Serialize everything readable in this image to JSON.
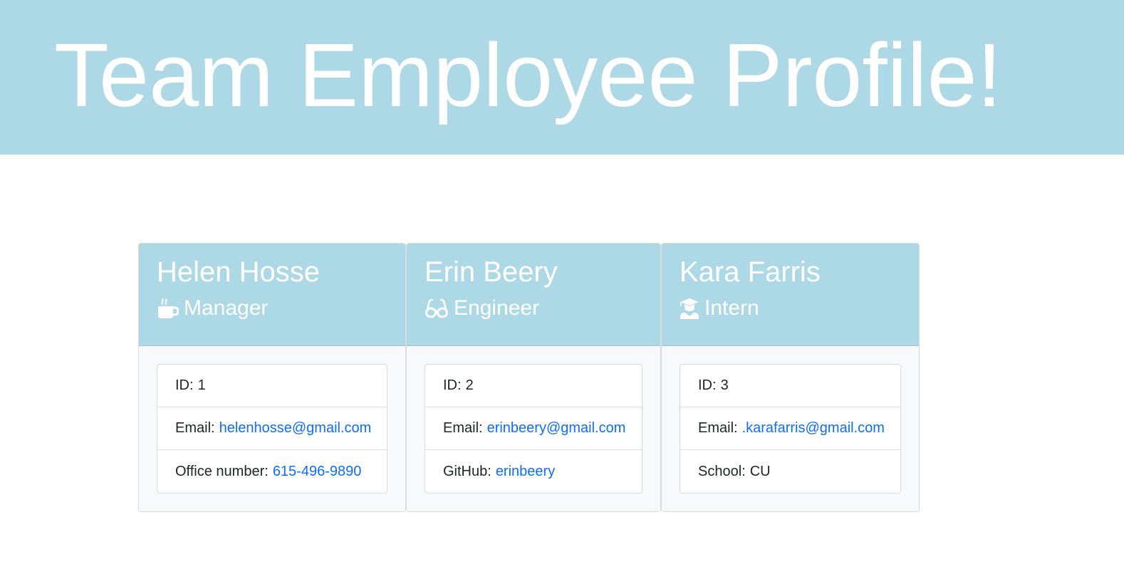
{
  "header": {
    "title": "Team Employee Profile!",
    "background_color": "#add8e6",
    "text_color": "#ffffff"
  },
  "accent": {
    "link_color": "#0d6efd"
  },
  "employees": [
    {
      "name": "Helen Hosse",
      "role": "Manager",
      "role_icon": "coffee-mug-icon",
      "id_label": "ID:",
      "id_value": "1",
      "email_label": "Email:",
      "email": "helenhosse@gmail.com",
      "extra_label": "Office number:",
      "extra_value": "615-496-9890"
    },
    {
      "name": "Erin Beery",
      "role": "Engineer",
      "role_icon": "glasses-icon",
      "id_label": "ID:",
      "id_value": "2",
      "email_label": "Email:",
      "email": "erinbeery@gmail.com",
      "extra_label": "GitHub:",
      "extra_value": "erinbeery"
    },
    {
      "name": "Kara Farris",
      "role": "Intern",
      "role_icon": "graduate-icon",
      "id_label": "ID:",
      "id_value": "3",
      "email_label": "Email:",
      "email": ".karafarris@gmail.com",
      "extra_label": "School:",
      "extra_value": "CU"
    }
  ]
}
